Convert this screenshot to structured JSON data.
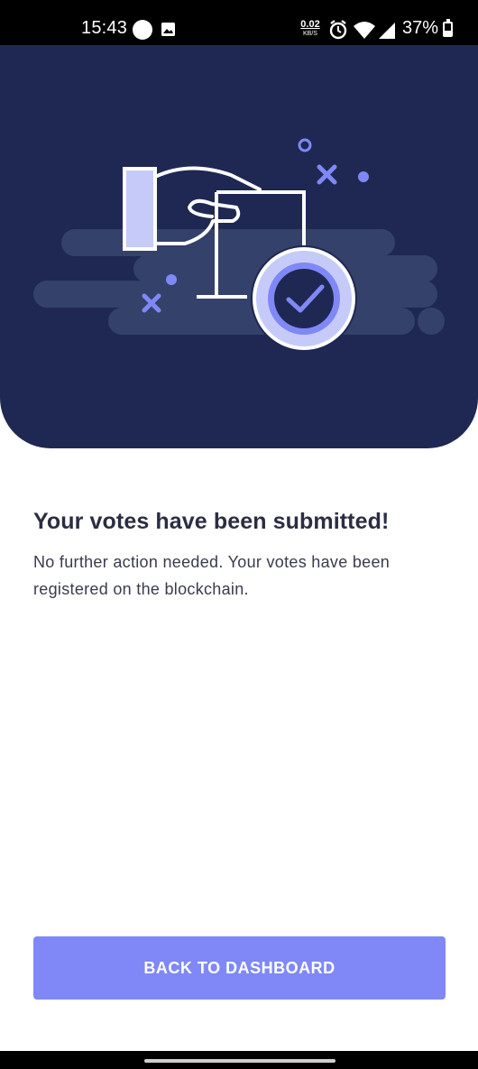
{
  "status_bar": {
    "time": "15:43",
    "net_speed_value": "0.02",
    "net_speed_unit": "KB/S",
    "battery_percent": "37%",
    "battery_level": 0.37
  },
  "hero": {
    "background_color": "#1f2853",
    "accent_color": "#7f88f6"
  },
  "content": {
    "title": "Your votes have been submitted!",
    "description": "No further action needed. Your votes have been registered on the blockchain."
  },
  "actions": {
    "back_label": "BACK TO DASHBOARD",
    "back_color": "#7f88f6"
  },
  "icons": [
    "notification-dot-icon",
    "image-icon",
    "alarm-icon",
    "wifi-icon",
    "signal-icon",
    "battery-icon",
    "ballot-check-illustration"
  ]
}
